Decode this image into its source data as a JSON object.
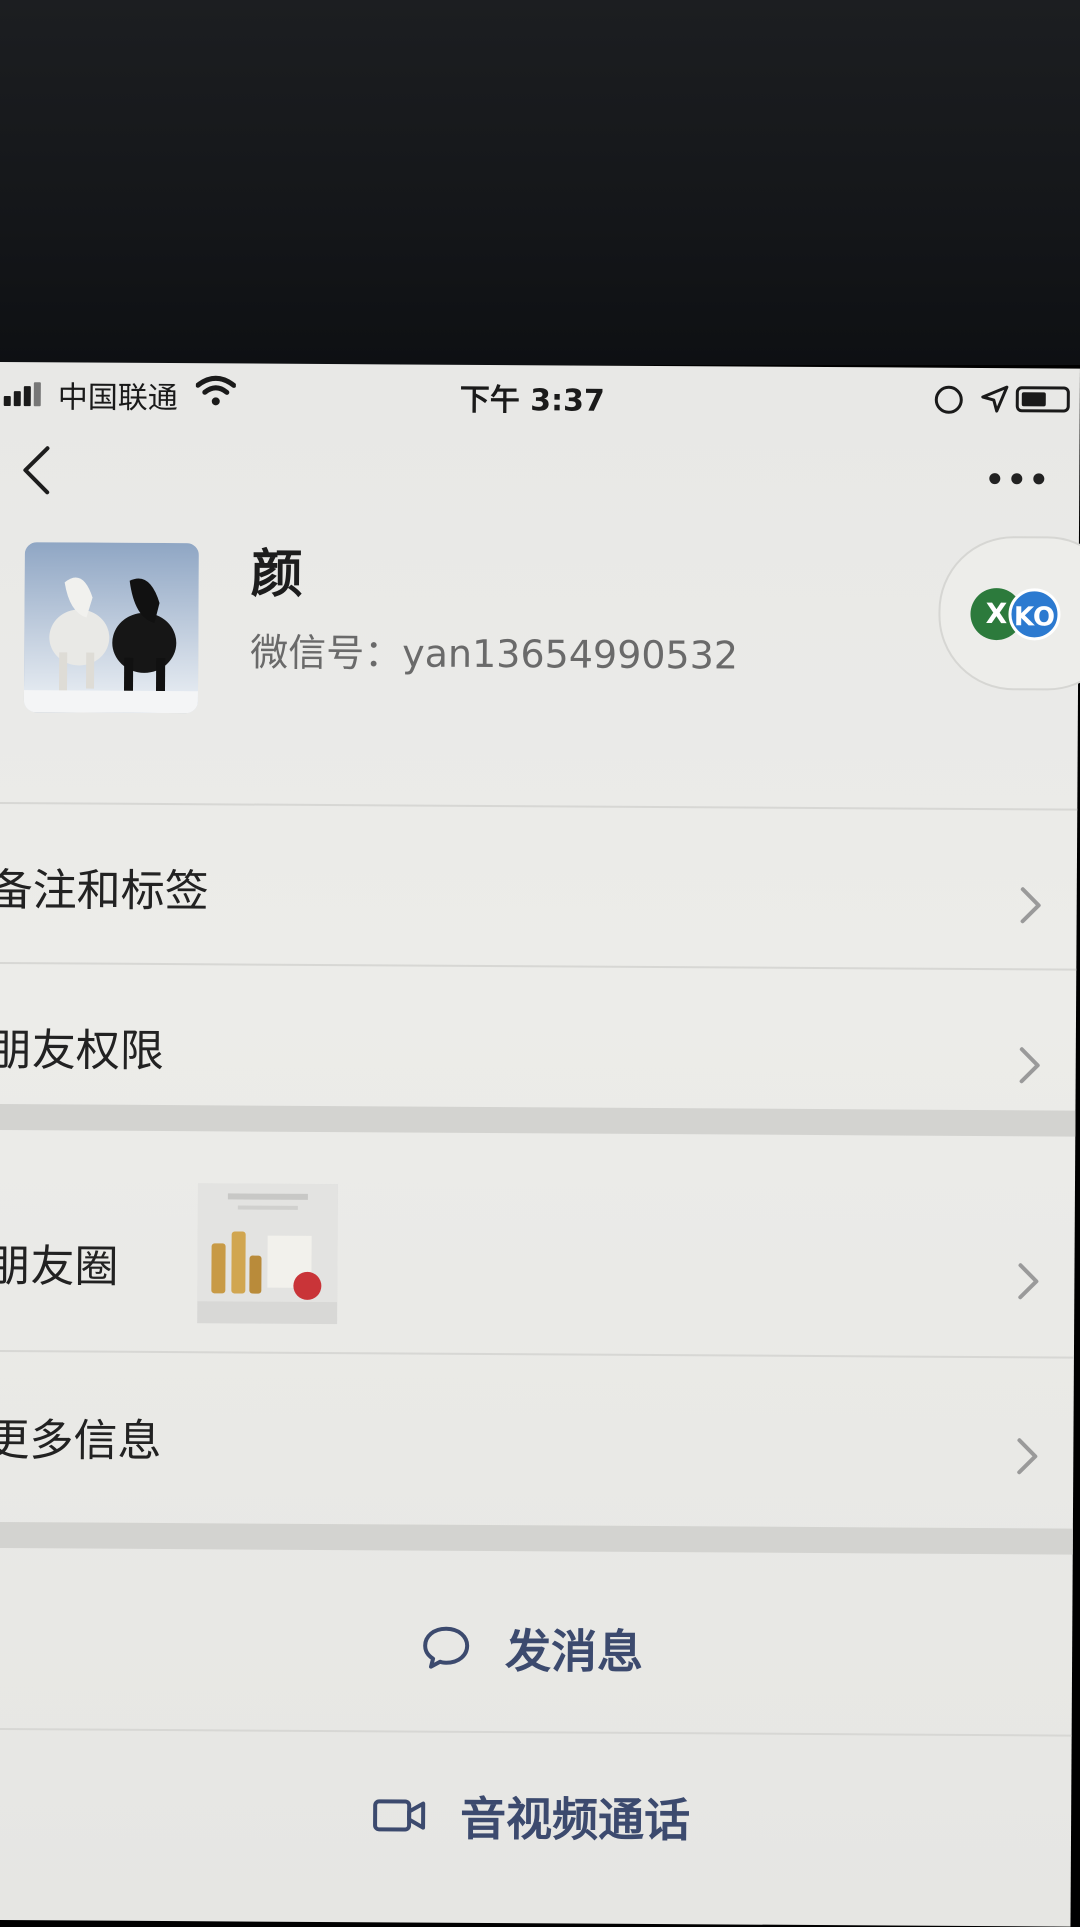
{
  "status_bar": {
    "carrier": "中国联通",
    "time": "下午 3:37"
  },
  "icons": {
    "back": "back-chevron-icon",
    "more": "more-dots-icon",
    "wifi": "wifi-icon",
    "battery": "battery-icon",
    "location": "location-arrow-icon",
    "rotation_lock": "rotation-lock-icon",
    "message": "chat-bubble-icon",
    "video": "video-camera-icon"
  },
  "profile": {
    "name": "颜",
    "wechat_id": "微信号：yan13654990532",
    "badge_left": "X",
    "badge_right": "KO"
  },
  "rows": [
    {
      "label": "备注和标签"
    },
    {
      "label": "朋友权限"
    },
    {
      "label": "朋友圈"
    },
    {
      "label": "更多信息"
    }
  ],
  "actions": {
    "send_message": "发消息",
    "av_call": "音视频通话"
  },
  "colors": {
    "action_text": "#3c4a6e",
    "background": "#e9e9e6",
    "badge_green": "#2c7a3c",
    "badge_blue": "#2c7ad0"
  }
}
